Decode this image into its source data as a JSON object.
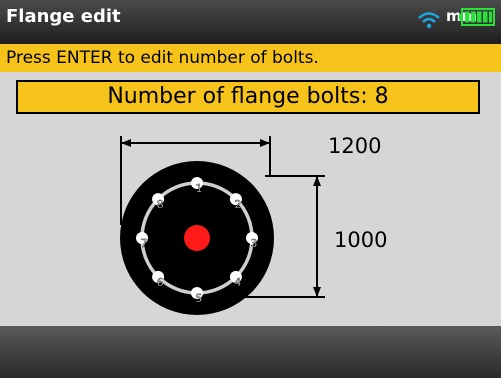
{
  "header": {
    "title": "Flange edit",
    "unit": "mm",
    "wifi_icon": "wifi-icon",
    "battery_icon": "battery-icon",
    "battery_level": 1.0,
    "accent_color": "#19a8e0",
    "battery_color": "#27e03a"
  },
  "prompt": {
    "text": "Press ENTER to edit number of bolts."
  },
  "field": {
    "label": "Number of flange bolts: 8",
    "highlight_color": "#f6c31b"
  },
  "flange": {
    "bolt_count": 8,
    "bolt_labels": [
      "1",
      "2",
      "3",
      "4",
      "5",
      "6",
      "7",
      "8"
    ],
    "width_value": "1200",
    "height_value": "1000",
    "center_color": "#ff1a1a"
  }
}
